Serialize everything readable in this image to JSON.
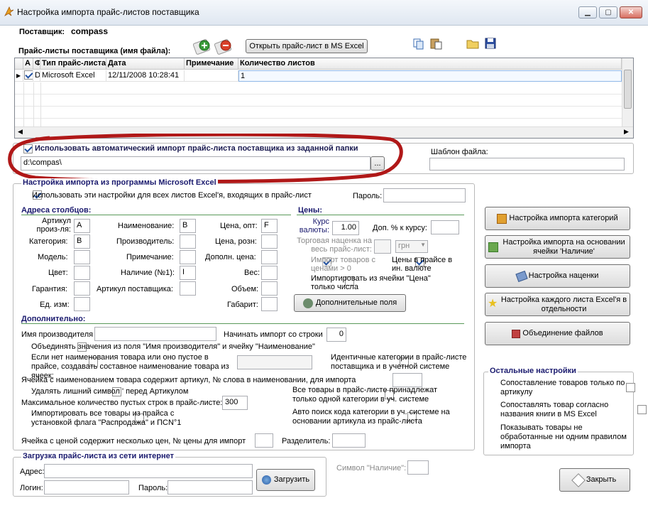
{
  "window": {
    "title": "Настройка импорта прайс-листов поставщика"
  },
  "supplier": {
    "label": "Поставщик:",
    "value": "compass"
  },
  "pricelists": {
    "label": "Прайс-листы поставщика (имя файла):",
    "open_excel_button": "Открыть прайс-лист в MS Excel",
    "columns": [
      "А",
      "Ф",
      "Тип прайс-листа",
      "Дата",
      "Примечание",
      "Количество листов"
    ],
    "rows": [
      {
        "a": "",
        "f": "D",
        "type": "Microsoft Excel",
        "date": "12/11/2008 10:28:41",
        "note": "",
        "sheets": "1"
      }
    ]
  },
  "auto_import": {
    "label": "Использовать автоматический импорт прайс-листа поставщика из заданной папки",
    "path": "d:\\compas\\",
    "browse": "...",
    "template_label": "Шаблон файла:",
    "template_value": ""
  },
  "excel_settings": {
    "title": "Настройка импорта из программы Microsoft Excel",
    "use_all_sheets": "Использовать эти настройки для всех листов Excel'я, входящих в прайс-лист",
    "password_label": "Пароль:",
    "password_value": ""
  },
  "columns_section": {
    "title": "Адреса столбцов:",
    "article_label": "Артикул произ-ля:",
    "article_value": "A",
    "category_label": "Категория:",
    "category_value": "B",
    "model_label": "Модель:",
    "color_label": "Цвет:",
    "warranty_label": "Гарантия:",
    "unit_label": "Ед. изм:",
    "name_label": "Наименование:",
    "name_value": "B",
    "manufacturer_label": "Производитель:",
    "note_label": "Примечание:",
    "stock_label": "Наличие (№1):",
    "stock_value": "I",
    "supplier_article_label": "Артикул поставщика:",
    "price_opt_label": "Цена, опт:",
    "price_opt_value": "F",
    "price_retail_label": "Цена, розн:",
    "price_extra_label": "Дополн. цена:",
    "weight_label": "Вес:",
    "volume_label": "Объем:",
    "size_label": "Габарит:"
  },
  "prices_section": {
    "title": "Цены:",
    "rate_label": "Курс валюты:",
    "rate_value": "1.00",
    "add_pct_label": "Доп. % к курсу:",
    "markup_label": "Торговая наценка на весь прайс-лист:",
    "currency": "грн",
    "import_positive": "Импорт товаров с ценами > 0",
    "prices_in_foreign": "Цены в прайсе в ин. валюте",
    "import_from_price": "Импортировать из ячейки \"Цена\" только числа",
    "extra_fields_button": "Дополнительные поля"
  },
  "additional": {
    "title": "Дополнительно:",
    "manufacturer_name_label": "Имя производителя",
    "start_row_label": "Начинать импорт со строки",
    "start_row_value": "0",
    "merge_label": "Объединять значения из поля \"Имя производителя\" и ячейку \"Наименование\"",
    "compose_label": "Если нет наименования товара или оно пустое в прайсе, создавать составное наименование товара из ячеек:",
    "identical_label": "Идентичные категории в прайс-листе поставщика и в учетной системе",
    "word_number_label": "Ячейка с наименованием товара содержит артикул, № слова в наименовании, для импорта",
    "remove_symbol_label": "Удалять лишний символ ' перед Артикулом",
    "all_in_one_label": "Все товары в прайс-листе принадлежат только одной категории в уч. системе",
    "max_empty_label": "Максимальное количество пустых строк в прайс-листе:",
    "max_empty_value": "300",
    "sale_label": "Импортировать все товары из прайса с установкой флага \"Распродажа\" и ПСN°1",
    "auto_search_label": "Авто поиск кода категории в уч. системе на основании артикула из прайс-листа",
    "multi_price_label": "Ячейка с ценой содержит несколько цен, № цены для импорт",
    "separator_label": "Разделитель:"
  },
  "internet": {
    "title": "Загрузка прайс-листа из сети интернет",
    "address_label": "Адрес:",
    "login_label": "Логин:",
    "password_label": "Пароль:",
    "load_button": "Загрузить"
  },
  "stock_symbol_label": "Символ \"Наличие\":",
  "right_buttons": [
    "Настройка импорта категорий",
    "Настройка импорта на основании ячейки 'Наличие'",
    "Настройка наценки",
    "Настройка каждого листа Excel'я в отдельности",
    "Объединение файлов"
  ],
  "other_settings": {
    "title": "Остальные настройки",
    "items": [
      "Сопоставление товаров только по артикулу",
      "Сопоставлять товар согласно названия книги в MS Excel",
      "Показывать товары не обработанные ни одним правилом импорта"
    ]
  },
  "close_button": "Закрыть"
}
